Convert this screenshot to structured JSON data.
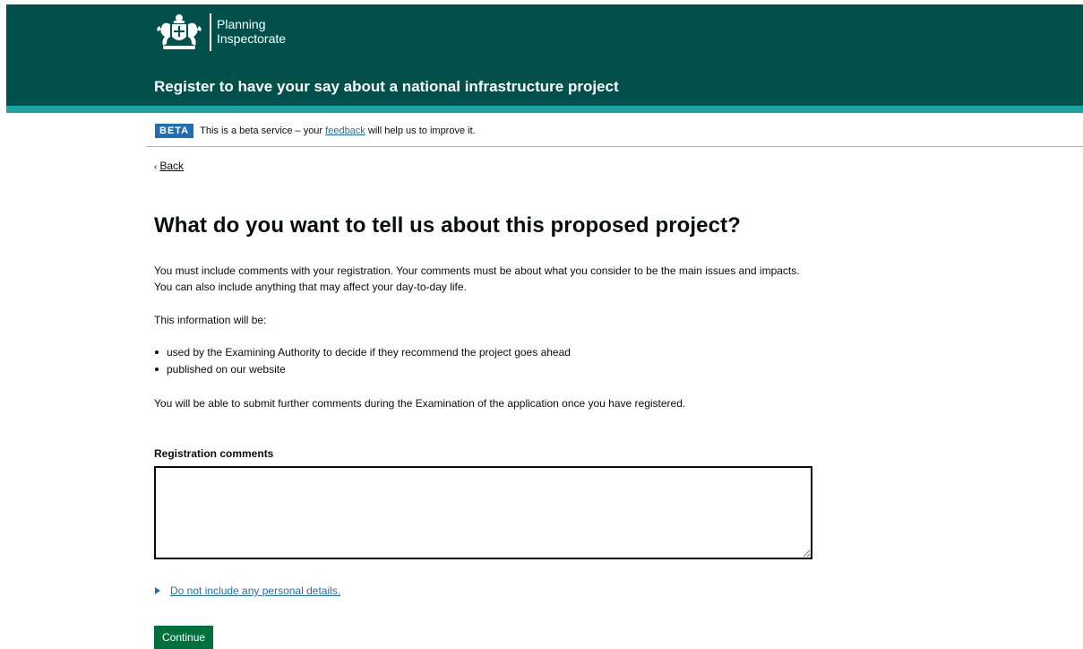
{
  "header": {
    "org_name": "Planning\nInspectorate",
    "service_name": "Register to have your say about a national infrastructure project",
    "crest_icon": "royal-coat-of-arms-icon"
  },
  "phase_banner": {
    "tag": "BETA",
    "text_before": "This is a beta service – your ",
    "link_text": "feedback",
    "text_after": " will help us to improve it."
  },
  "back_link": {
    "label": "Back"
  },
  "main": {
    "title": "What do you want to tell us about this proposed project?",
    "intro": "You must include comments with your registration. Your comments must be about what you consider to be the main issues and impacts. You can also include anything that may affect your day-to-day life.",
    "info_lead": "This information will be:",
    "bullets": [
      "used by the Examining Authority to decide if they recommend the project goes ahead",
      "published on our website"
    ],
    "further": "You will be able to submit further comments during the Examination of the application once you have registered.",
    "field_label": "Registration comments",
    "field_value": "",
    "details_summary": "Do not include any personal details.",
    "continue_label": "Continue"
  },
  "colors": {
    "header_bg": "#01504b",
    "header_stripe": "#1ea3a0",
    "link": "#1d70b8",
    "button": "#00703c"
  }
}
